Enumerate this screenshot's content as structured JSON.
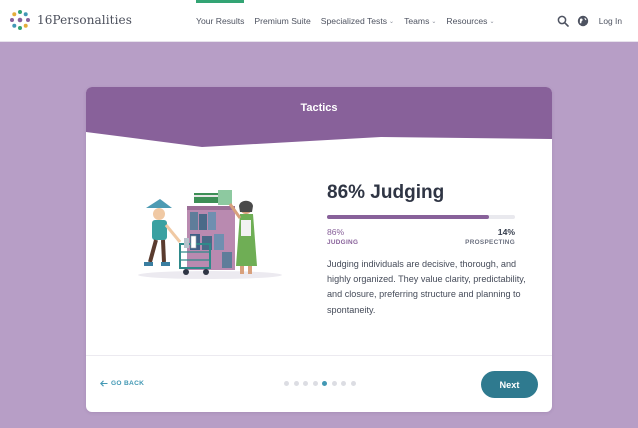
{
  "header": {
    "brand": "16Personalities",
    "nav": [
      {
        "label": "Your Results",
        "active": true
      },
      {
        "label": "Premium Suite"
      },
      {
        "label": "Specialized Tests",
        "caret": "⌄"
      },
      {
        "label": "Teams",
        "caret": "⌄"
      },
      {
        "label": "Resources",
        "caret": "⌄"
      }
    ],
    "login_label": "Log In",
    "icons": [
      "search-icon",
      "globe-icon"
    ]
  },
  "card": {
    "title": "Tactics",
    "heading": "86% Judging",
    "trait": {
      "percent_shown": 86,
      "left_percent": "86%",
      "right_percent": "14%",
      "left_label": "JUDGING",
      "right_label": "PROSPECTING"
    },
    "description": "Judging individuals are decisive, thorough, and highly organized. They value clarity, predictability, and closure, preferring structure and planning to spontaneity.",
    "back_label": "GO BACK",
    "next_label": "Next",
    "pagination": {
      "total": 8,
      "current": 5
    }
  },
  "colors": {
    "page_background": "#b79ec6",
    "card_band": "#88619a",
    "accent_purple": "#88619a",
    "nav_active": "#33a474",
    "next_button": "#2f7a8f",
    "link_blue": "#4298b4"
  }
}
